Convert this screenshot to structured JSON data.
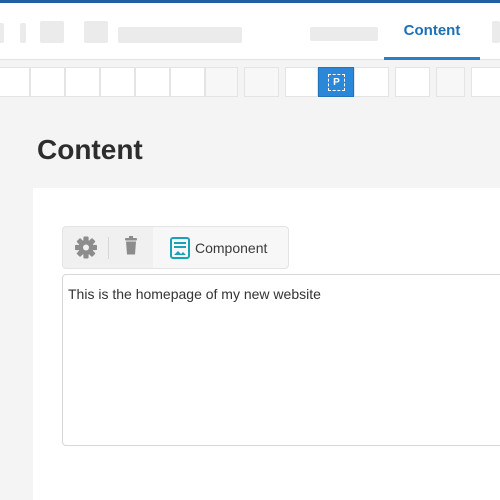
{
  "header": {
    "active_tab": "Content"
  },
  "page": {
    "title": "Content"
  },
  "toolbar": {
    "paragraph_button_label": "P",
    "paragraph_button_color": "#2b88d9"
  },
  "component_toolbar": {
    "settings_icon": "gear-icon",
    "delete_icon": "trash-icon",
    "component_icon": "component-icon",
    "component_label": "Component"
  },
  "editor": {
    "content": "This is the homepage of my new website"
  },
  "colors": {
    "accent": "#1f6fb3",
    "component_icon": "#1aa3b8"
  }
}
